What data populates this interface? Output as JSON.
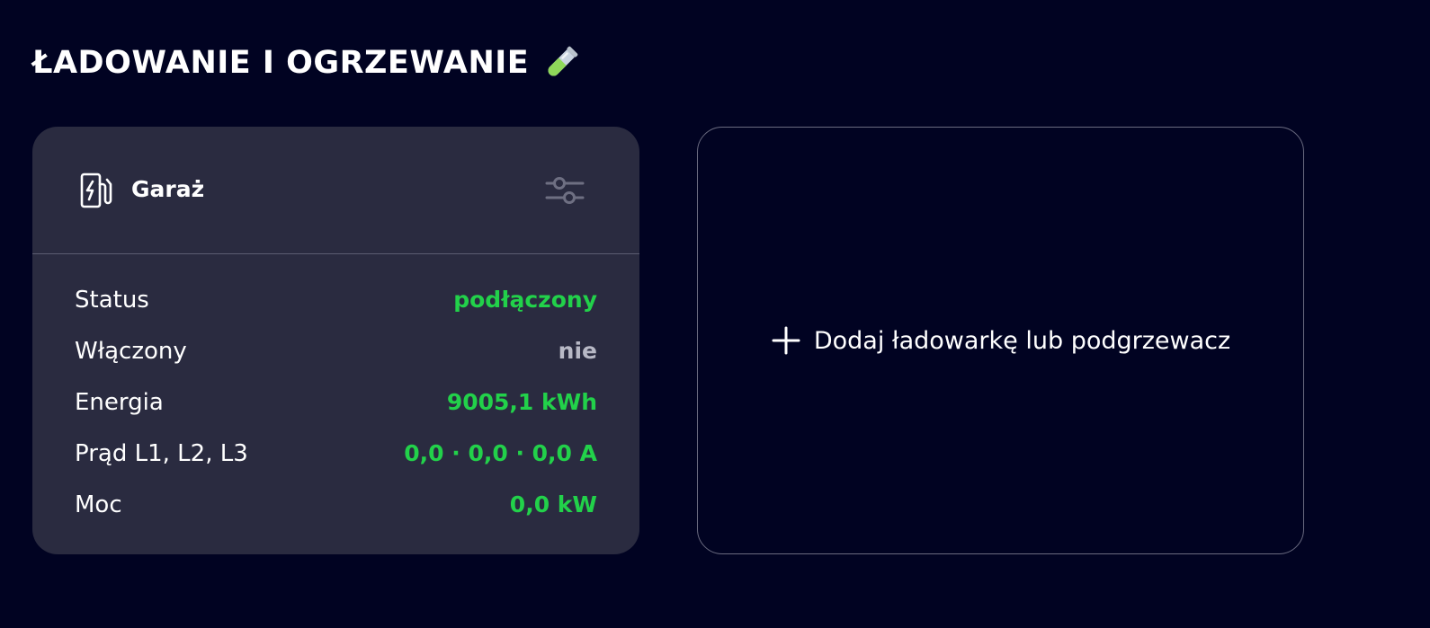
{
  "section": {
    "title": "ŁADOWANIE I OGRZEWANIE",
    "title_icon": "test-tube-icon"
  },
  "device_card": {
    "icon": "ev-charger-icon",
    "name": "Garaż",
    "settings_icon": "sliders-icon",
    "rows": [
      {
        "label": "Status",
        "value": "podłączony",
        "color": "#22d14a"
      },
      {
        "label": "Włączony",
        "value": "nie",
        "color": "#b8b9c6"
      },
      {
        "label": "Energia",
        "value": "9005,1 kWh",
        "color": "#22d14a"
      },
      {
        "label": "Prąd L1, L2, L3",
        "value": "0,0 · 0,0 · 0,0 A",
        "color": "#22d14a"
      },
      {
        "label": "Moc",
        "value": "0,0 kW",
        "color": "#22d14a"
      }
    ]
  },
  "add_card": {
    "icon": "plus-icon",
    "label": "Dodaj ładowarkę lub podgrzewacz"
  },
  "colors": {
    "background": "#010322",
    "card": "#2a2b40",
    "accent_green": "#22d14a",
    "muted": "#b8b9c6"
  }
}
